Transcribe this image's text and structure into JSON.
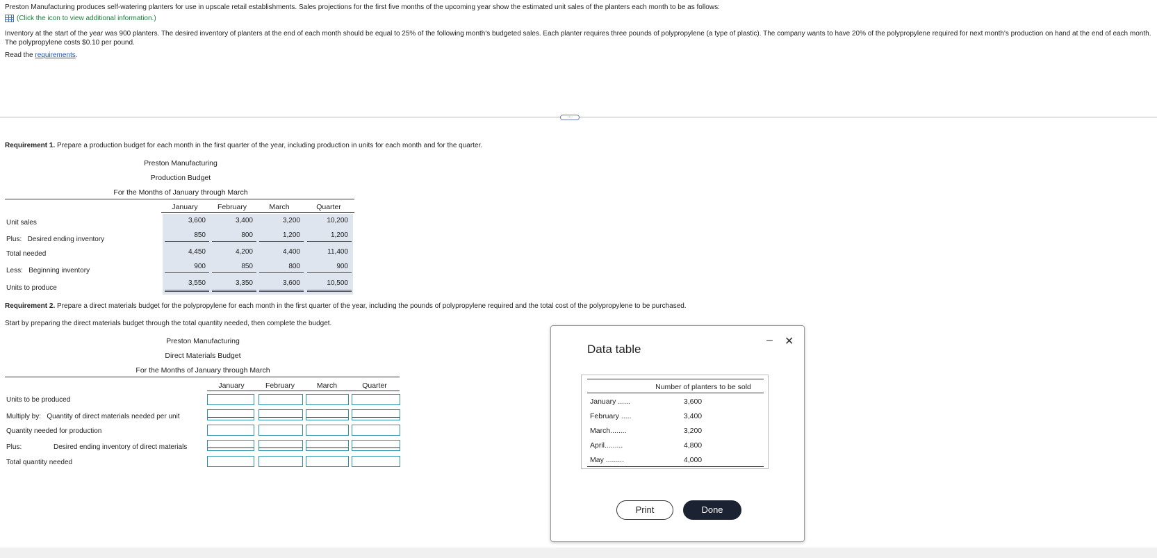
{
  "intro": {
    "line1": "Preston Manufacturing produces self-watering planters for use in upscale retail establishments. Sales projections for the first five months of the upcoming year show the estimated unit sales of the planters each month to be as follows:",
    "info_link": "(Click the icon to view additional information.)",
    "line2": "Inventory at the start of the year was 900 planters. The desired inventory of planters at the end of each month should be equal to 25% of the following month's budgeted sales. Each planter requires three pounds of polypropylene (a type of plastic). The company wants to have 20% of the polypropylene required for next month's production on hand at the end of each month. The polypropylene costs $0.10 per pound.",
    "read_prefix": "Read the ",
    "read_link": "requirements",
    "read_suffix": "."
  },
  "more_button": "····",
  "req1": {
    "bold": "Requirement 1.",
    "text": " Prepare a production budget for each month in the first quarter of the year, including production in units for each month and for the quarter.",
    "company": "Preston Manufacturing",
    "budget_title": "Production Budget",
    "period": "For the Months of January through March",
    "columns": [
      "January",
      "February",
      "March",
      "Quarter"
    ],
    "rows": [
      {
        "label": "Unit sales",
        "values": [
          "3,600",
          "3,400",
          "3,200",
          "10,200"
        ]
      },
      {
        "label": "Plus:   Desired ending inventory",
        "values": [
          "850",
          "800",
          "1,200",
          "1,200"
        ]
      },
      {
        "label": "Total needed",
        "values": [
          "4,450",
          "4,200",
          "4,400",
          "11,400"
        ]
      },
      {
        "label": "Less:   Beginning inventory",
        "values": [
          "900",
          "850",
          "800",
          "900"
        ]
      },
      {
        "label": "Units to produce",
        "values": [
          "3,550",
          "3,350",
          "3,600",
          "10,500"
        ]
      }
    ]
  },
  "req2": {
    "bold": "Requirement 2.",
    "text": " Prepare a direct materials budget for the polypropylene for each month in the first quarter of the year, including the pounds of polypropylene required and the total cost of the polypropylene to be purchased.",
    "instruction": "Start by preparing the direct materials budget through the total quantity needed, then complete the budget.",
    "company": "Preston Manufacturing",
    "budget_title": "Direct Materials Budget",
    "period": "For the Months of January through March",
    "columns": [
      "January",
      "February",
      "March",
      "Quarter"
    ],
    "rows": [
      {
        "label": "Units to be produced"
      },
      {
        "label": "Multiply by:   Quantity of direct materials needed per unit"
      },
      {
        "label": "Quantity needed for production"
      },
      {
        "label_prefix": "Plus:",
        "label": "Desired ending inventory of direct materials"
      },
      {
        "label": "Total quantity needed"
      }
    ]
  },
  "modal": {
    "title": "Data table",
    "minimize": "–",
    "close": "✕",
    "column_header": "Number of planters to be sold",
    "rows": [
      {
        "month": "January ......",
        "value": "3,600"
      },
      {
        "month": "February .....",
        "value": "3,400"
      },
      {
        "month": "March........",
        "value": "3,200"
      },
      {
        "month": "April.........",
        "value": "4,800"
      },
      {
        "month": "May .........",
        "value": "4,000"
      }
    ],
    "print_label": "Print",
    "done_label": "Done"
  }
}
